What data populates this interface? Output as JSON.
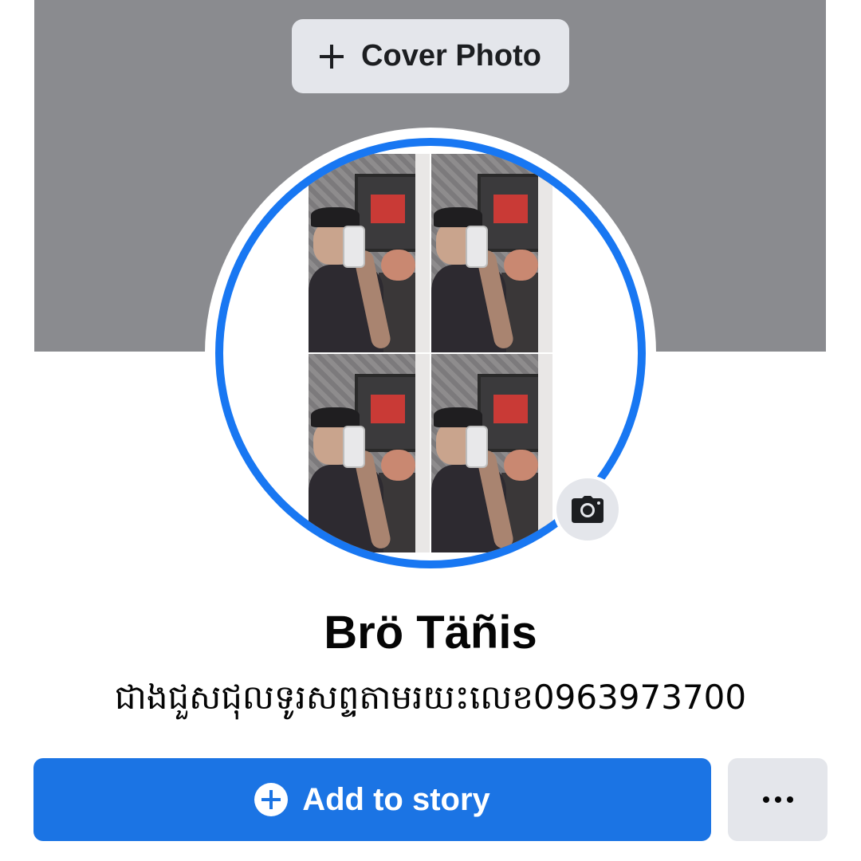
{
  "cover": {
    "button_label": "Cover Photo",
    "background_color": "#8a8b8f",
    "icon": "plus-icon"
  },
  "avatar": {
    "ring_color": "#1877f2",
    "photo_description_icon": "profile-photo",
    "camera_icon": "camera-icon"
  },
  "profile": {
    "name": "Brö Täñis",
    "bio": "ជាងជួសជុលទូរសព្ទតាមរយះលេខ0963973700"
  },
  "actions": {
    "add_story_label": "Add to story",
    "add_story_icon": "plus-circle-icon",
    "more_icon": "more-horizontal-icon",
    "primary_color": "#1b74e4"
  }
}
